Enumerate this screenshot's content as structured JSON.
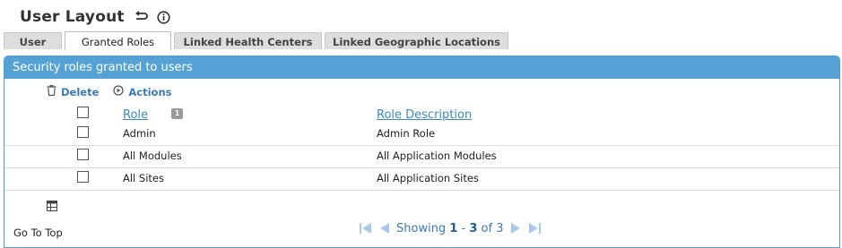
{
  "page": {
    "title": "User Layout",
    "icons": [
      "undo-arrow-icon",
      "info-icon"
    ]
  },
  "tabs": [
    {
      "label": "User",
      "active": false
    },
    {
      "label": "Granted Roles",
      "active": true
    },
    {
      "label": "Linked Health Centers",
      "active": false
    },
    {
      "label": "Linked Geographic Locations",
      "active": false
    }
  ],
  "panel": {
    "title": "Security roles granted to users",
    "toolbar": {
      "delete_label": "Delete",
      "actions_label": "Actions"
    },
    "columns": {
      "role": "Role",
      "description": "Role Description",
      "sort_index": "1"
    },
    "rows": [
      {
        "role": "Admin",
        "description": "Admin Role"
      },
      {
        "role": "All Modules",
        "description": "All Application Modules"
      },
      {
        "role": "All Sites",
        "description": "All Application Sites"
      }
    ]
  },
  "footer": {
    "go_top": "Go To Top",
    "pager": {
      "showing": "Showing",
      "from": "1",
      "sep": "-",
      "to": "3",
      "of": "of",
      "total": "3"
    }
  },
  "colors": {
    "accent": "#55a3d6",
    "link": "#3a7ab7"
  }
}
